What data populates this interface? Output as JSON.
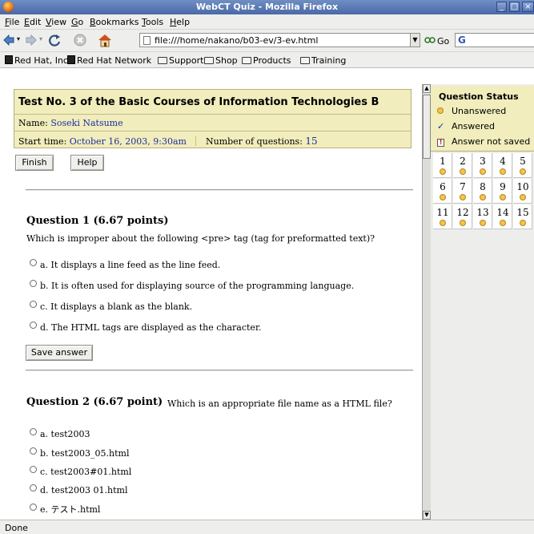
{
  "window": {
    "title": "WebCT Quiz - Mozilla Firefox"
  },
  "menu": [
    "File",
    "Edit",
    "View",
    "Go",
    "Bookmarks",
    "Tools",
    "Help"
  ],
  "nav": {
    "url": "file:///home/nakano/b03-ev/3-ev.html",
    "go_label": "Go"
  },
  "bookmarks": [
    "Red Hat, Inc.",
    "Red Hat Network",
    "Support",
    "Shop",
    "Products",
    "Training"
  ],
  "quiz": {
    "title": "Test No. 3 of the Basic Courses of Information Technologies B",
    "name_label": "Name:",
    "name_value": "Soseki Natsume",
    "start_label": "Start time:",
    "start_value": "October 16, 2003, 9:30am",
    "count_label": "Number of questions:",
    "count_value": "15",
    "finish_label": "Finish",
    "help_label": "Help"
  },
  "questions": [
    {
      "heading": "Question 1   (6.67 points)",
      "text": "Which is improper about the following <pre> tag (tag for preformatted text)?",
      "options": [
        "a. It displays a line feed as the line feed.",
        "b. It is often used for displaying source of the programming language.",
        "c. It displays a blank as the blank.",
        "d. The HTML tags are displayed as the character."
      ],
      "save_label": "Save answer"
    },
    {
      "heading": "Question 2   (6.67 point)",
      "text": "Which is an appropriate file name as a HTML file?",
      "options": [
        "a. test2003",
        "b. test2003_05.html",
        "c. test2003#01.html",
        "d. test2003 01.html",
        "e. テスト.html"
      ]
    }
  ],
  "status_panel": {
    "title": "Question Status",
    "unanswered": "Unanswered",
    "answered": "Answered",
    "not_saved": "Answer not saved",
    "numbers": [
      "1",
      "2",
      "3",
      "4",
      "5",
      "6",
      "7",
      "8",
      "9",
      "10",
      "11",
      "12",
      "13",
      "14",
      "15"
    ]
  },
  "statusbar": {
    "text": "Done"
  },
  "colors": {
    "header_bg": "#f1edbc",
    "link_navy": "#1a2f9f",
    "unanswered_dot": "#f6c24d",
    "not_saved_red": "#d02020"
  }
}
